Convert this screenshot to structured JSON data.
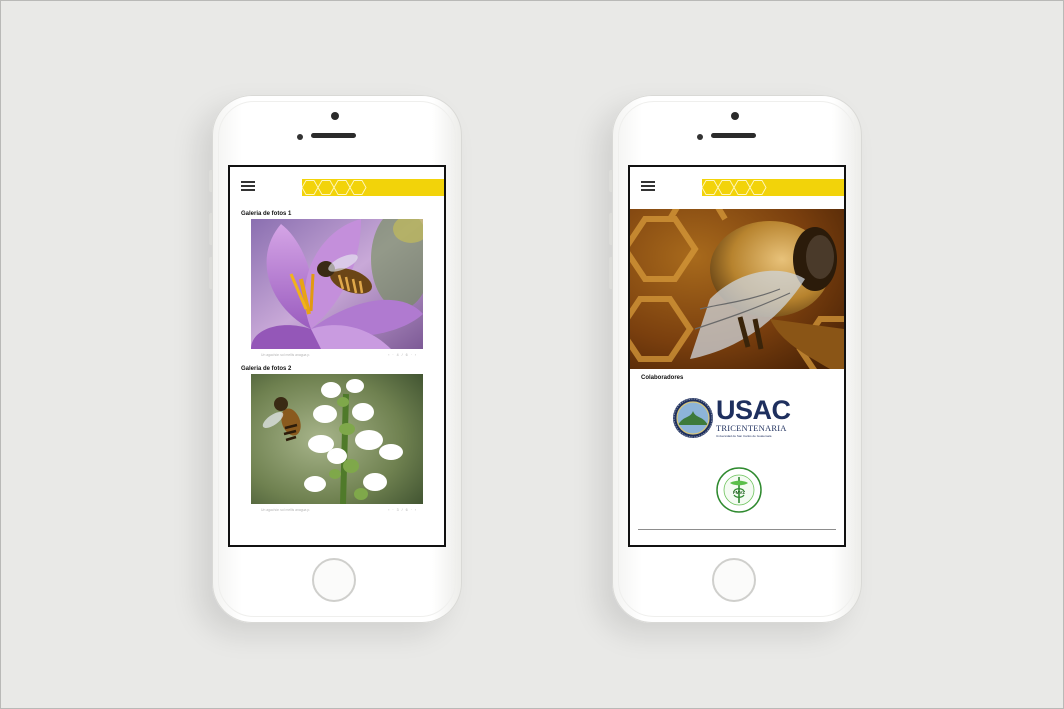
{
  "screen_left": {
    "gallery1_title": "Galeria de fotos 1",
    "gallery1_caption": "Un agachón sol mellis anagua p.",
    "gallery1_pager": "‹ · 4 / 6 · ›",
    "gallery2_title": "Galeria de fotos 2",
    "gallery2_caption": "Un agachón sol mellis anagua p.",
    "gallery2_pager": "‹ · 3 / 6 · ›"
  },
  "screen_right": {
    "collaborators_title": "Colaboradores",
    "usac_logo_text": "USAC",
    "usac_subtitle": "TRICENTENARIA",
    "usac_tagline": "Universidad de San Carlos de Guatemala",
    "faculty_logo_text": "FMVZ"
  },
  "colors": {
    "accent_yellow": "#f2d30a",
    "usac_blue": "#1e2f5e",
    "background": "#e9e9e7"
  },
  "icons": [
    "menu-icon",
    "hexagon-pattern-icon",
    "camera-icon",
    "home-button-icon"
  ]
}
